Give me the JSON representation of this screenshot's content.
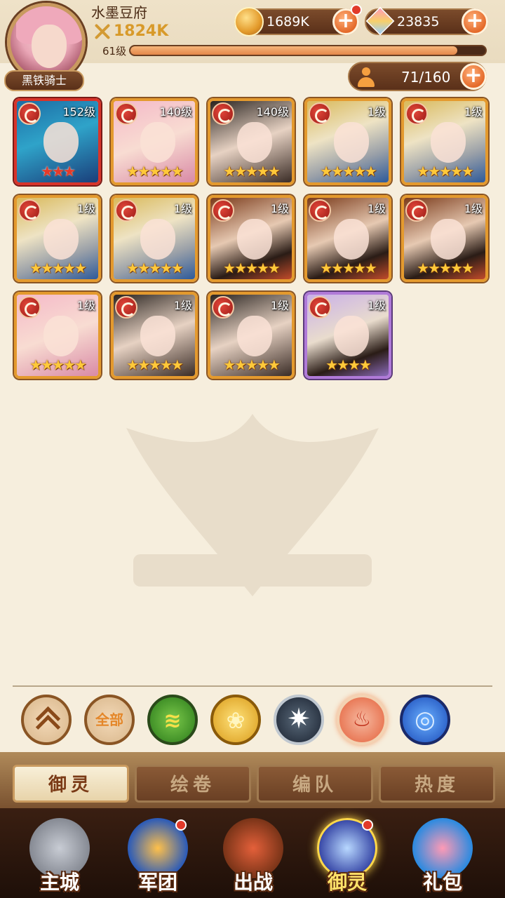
{
  "player": {
    "name": "水墨豆府",
    "power": "1824K",
    "level_label": "61级",
    "exp_fraction": 0.92,
    "rank": "黑铁骑士"
  },
  "resources": {
    "coins": "1689K",
    "gems": "23835",
    "roster": "71/160"
  },
  "heroes": [
    {
      "level": "152级",
      "stars": "★★★",
      "art": "blue",
      "frame": "red"
    },
    {
      "level": "140级",
      "stars": "★★★★★",
      "art": "pink",
      "frame": "orange"
    },
    {
      "level": "140级",
      "stars": "★★★★★",
      "art": "black",
      "frame": "orange"
    },
    {
      "level": "1级",
      "stars": "★★★★★",
      "art": "armor",
      "frame": "orange"
    },
    {
      "level": "1级",
      "stars": "★★★★★",
      "art": "armor",
      "frame": "orange"
    },
    {
      "level": "1级",
      "stars": "★★★★★",
      "art": "armor",
      "frame": "orange"
    },
    {
      "level": "1级",
      "stars": "★★★★★",
      "art": "armor",
      "frame": "orange"
    },
    {
      "level": "1级",
      "stars": "★★★★★",
      "art": "warrior",
      "frame": "orange"
    },
    {
      "level": "1级",
      "stars": "★★★★★",
      "art": "warrior",
      "frame": "orange"
    },
    {
      "level": "1级",
      "stars": "★★★★★",
      "art": "warrior",
      "frame": "orange"
    },
    {
      "level": "1级",
      "stars": "★★★★★",
      "art": "pink",
      "frame": "orange"
    },
    {
      "level": "1级",
      "stars": "★★★★★",
      "art": "black",
      "frame": "orange"
    },
    {
      "level": "1级",
      "stars": "★★★★★",
      "art": "black",
      "frame": "orange"
    },
    {
      "level": "1级",
      "stars": "★★★★",
      "art": "purplebg",
      "frame": "purple"
    }
  ],
  "filters": {
    "all_label": "全部"
  },
  "tabs": [
    "御灵",
    "绘卷",
    "编队",
    "热度"
  ],
  "nav": [
    "主城",
    "军团",
    "出战",
    "御灵",
    "礼包"
  ]
}
